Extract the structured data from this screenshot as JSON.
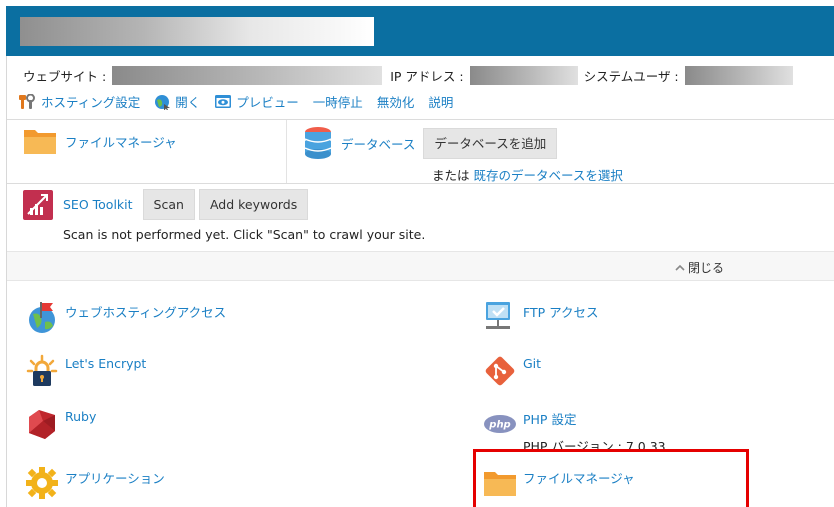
{
  "colors": {
    "accent": "#1a7fc4",
    "header_bg": "#0b6fa1",
    "highlight": "#e50000"
  },
  "site_info": {
    "website_label": "ウェブサイト :",
    "ip_label": "IP アドレス :",
    "system_user_label": "システムユーザ :"
  },
  "actions": [
    {
      "label": "ホスティング設定",
      "icon": "hosting-settings-icon"
    },
    {
      "label": "開く",
      "icon": "globe-open-icon"
    },
    {
      "label": "プレビュー",
      "icon": "preview-icon"
    },
    {
      "label": "一時停止"
    },
    {
      "label": "無効化"
    },
    {
      "label": "説明"
    }
  ],
  "file_manager": {
    "label": "ファイルマネージャ"
  },
  "databases": {
    "label": "データベース",
    "add_button": "データベースを追加",
    "or_text": "または",
    "select_link": "既存のデータベースを選択"
  },
  "seo": {
    "label": "SEO Toolkit",
    "scan_button": "Scan",
    "keywords_button": "Add keywords",
    "status": "Scan is not performed yet. Click \"Scan\" to crawl your site."
  },
  "collapse_label": "閉じる",
  "tiles": {
    "web_hosting_access": "ウェブホスティングアクセス",
    "ftp_access": "FTP アクセス",
    "lets_encrypt": "Let's Encrypt",
    "git": "Git",
    "ruby": "Ruby",
    "php_settings": "PHP 設定",
    "php_version": "PHP バージョン : 7.0.33",
    "applications": "アプリケーション",
    "file_manager": "ファイルマネージャ"
  }
}
